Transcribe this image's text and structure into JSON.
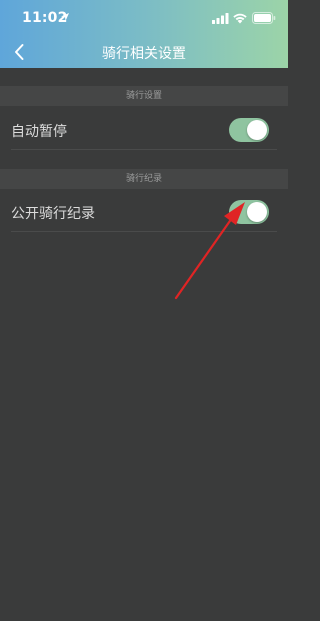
{
  "status_bar": {
    "time": "11:02"
  },
  "nav": {
    "title": "骑行相关设置",
    "back_icon": "chevron-left-icon"
  },
  "sections": [
    {
      "header": "骑行设置",
      "rows": [
        {
          "label": "自动暂停",
          "toggle_on": true
        }
      ]
    },
    {
      "header": "骑行纪录",
      "rows": [
        {
          "label": "公开骑行纪录",
          "toggle_on": true
        }
      ]
    }
  ],
  "colors": {
    "background": "#3a3b3b",
    "section_header_bg": "#454646",
    "toggle_on": "#8fc4a0",
    "header_gradient_start": "#5fa6da",
    "header_gradient_end": "#9cd4a8",
    "annotation_arrow": "#e02424"
  }
}
